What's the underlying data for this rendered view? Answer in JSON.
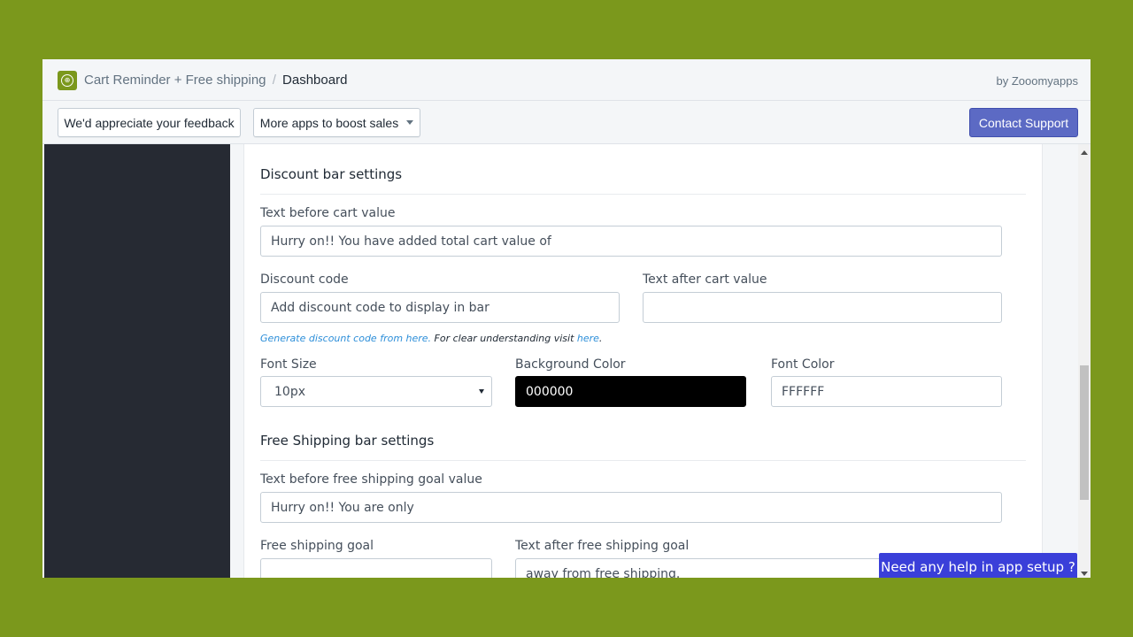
{
  "header": {
    "app_name": "Cart Reminder + Free shipping",
    "separator": "/",
    "page": "Dashboard",
    "by": "by Zooomyapps",
    "logo_icon": "cart-reminder-logo-icon",
    "logo_color": "#7b981c"
  },
  "toolbar": {
    "feedback_label": "We'd appreciate your feedback",
    "more_apps_label": "More apps to boost sales",
    "contact_label": "Contact Support",
    "contact_color": "#5c6ac4"
  },
  "discount_section": {
    "title": "Discount bar settings",
    "text_before_label": "Text before cart value",
    "text_before_value": "Hurry on!! You have added total cart value of",
    "discount_code_label": "Discount code",
    "discount_code_placeholder": "Add discount code to display in bar",
    "text_after_label": "Text after cart value",
    "text_after_value": "",
    "helper_link1": "Generate discount code from here.",
    "helper_middle": " For clear understanding visit ",
    "helper_link2": "here",
    "helper_end": ".",
    "font_size_label": "Font Size",
    "font_size_value": "10px",
    "bg_color_label": "Background Color",
    "bg_color_value": "000000",
    "font_color_label": "Font Color",
    "font_color_value": "FFFFFF"
  },
  "shipping_section": {
    "title": "Free Shipping bar settings",
    "text_before_label": "Text before free shipping goal value",
    "text_before_value": "Hurry on!! You are only",
    "goal_label": "Free shipping goal",
    "goal_value": "",
    "text_after_label": "Text after free shipping goal",
    "text_after_value": "away from free shipping."
  },
  "help": {
    "label": "Need any help in app setup ?",
    "color": "#3a3fd9"
  }
}
